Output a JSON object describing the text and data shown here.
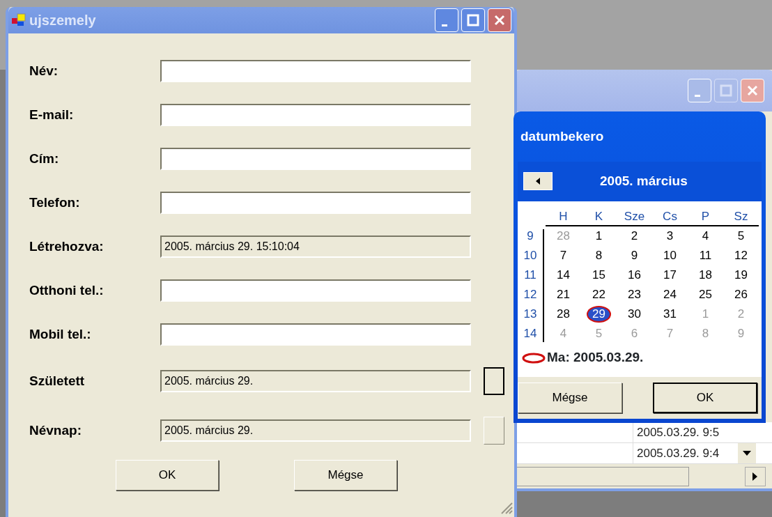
{
  "main_window": {
    "title": "ujszemely",
    "active": false,
    "fields": [
      {
        "label": "Név:",
        "readonly": false
      },
      {
        "label": "E-mail:",
        "readonly": false
      },
      {
        "label": "Cím:",
        "readonly": false
      },
      {
        "label": "Telefon:",
        "readonly": false
      },
      {
        "label": "Létrehozva:",
        "value": "2005. március 29. 15:10:04",
        "readonly": true
      },
      {
        "label": "Otthoni tel.:",
        "readonly": false
      },
      {
        "label": "Mobil tel.:",
        "readonly": false
      },
      {
        "label": "Született",
        "value": "2005. március 29.",
        "readonly": true,
        "picker": {
          "focused": true
        }
      },
      {
        "label": "Névnap:",
        "value": "2005. március 29.",
        "readonly": true,
        "picker": {
          "focused": false
        }
      }
    ],
    "buttons": [
      {
        "label": "OK",
        "default": false
      },
      {
        "label": "Mégse",
        "default": false
      }
    ]
  },
  "background_window": {
    "active": false,
    "maximize_disabled": true,
    "rows": [
      {
        "cells": [
          "2005.03.29. 9:5"
        ]
      },
      {
        "cells": [
          "2005.03.29. 9:4"
        ]
      }
    ]
  },
  "date_dialog": {
    "title": "datumbekero",
    "active": true,
    "month_label": "2005. március",
    "weekdays": [
      "H",
      "K",
      "Sze",
      "Cs",
      "P",
      "Sz"
    ],
    "weeks": [
      {
        "number": "9",
        "days": [
          {
            "day": "28",
            "other_month": true,
            "selected": false,
            "today": false
          },
          {
            "day": "1",
            "other_month": false,
            "selected": false,
            "today": false
          },
          {
            "day": "2",
            "other_month": false,
            "selected": false,
            "today": false
          },
          {
            "day": "3",
            "other_month": false,
            "selected": false,
            "today": false
          },
          {
            "day": "4",
            "other_month": false,
            "selected": false,
            "today": false
          },
          {
            "day": "5",
            "other_month": false,
            "selected": false,
            "today": false
          }
        ]
      },
      {
        "number": "10",
        "days": [
          {
            "day": "7",
            "other_month": false,
            "selected": false,
            "today": false
          },
          {
            "day": "8",
            "other_month": false,
            "selected": false,
            "today": false
          },
          {
            "day": "9",
            "other_month": false,
            "selected": false,
            "today": false
          },
          {
            "day": "10",
            "other_month": false,
            "selected": false,
            "today": false
          },
          {
            "day": "11",
            "other_month": false,
            "selected": false,
            "today": false
          },
          {
            "day": "12",
            "other_month": false,
            "selected": false,
            "today": false
          }
        ]
      },
      {
        "number": "11",
        "days": [
          {
            "day": "14",
            "other_month": false,
            "selected": false,
            "today": false
          },
          {
            "day": "15",
            "other_month": false,
            "selected": false,
            "today": false
          },
          {
            "day": "16",
            "other_month": false,
            "selected": false,
            "today": false
          },
          {
            "day": "17",
            "other_month": false,
            "selected": false,
            "today": false
          },
          {
            "day": "18",
            "other_month": false,
            "selected": false,
            "today": false
          },
          {
            "day": "19",
            "other_month": false,
            "selected": false,
            "today": false
          }
        ]
      },
      {
        "number": "12",
        "days": [
          {
            "day": "21",
            "other_month": false,
            "selected": false,
            "today": false
          },
          {
            "day": "22",
            "other_month": false,
            "selected": false,
            "today": false
          },
          {
            "day": "23",
            "other_month": false,
            "selected": false,
            "today": false
          },
          {
            "day": "24",
            "other_month": false,
            "selected": false,
            "today": false
          },
          {
            "day": "25",
            "other_month": false,
            "selected": false,
            "today": false
          },
          {
            "day": "26",
            "other_month": false,
            "selected": false,
            "today": false
          }
        ]
      },
      {
        "number": "13",
        "days": [
          {
            "day": "28",
            "other_month": false,
            "selected": false,
            "today": false
          },
          {
            "day": "29",
            "other_month": false,
            "selected": true,
            "today": true
          },
          {
            "day": "30",
            "other_month": false,
            "selected": false,
            "today": false
          },
          {
            "day": "31",
            "other_month": false,
            "selected": false,
            "today": false
          },
          {
            "day": "1",
            "other_month": true,
            "selected": false,
            "today": false
          },
          {
            "day": "2",
            "other_month": true,
            "selected": false,
            "today": false
          }
        ]
      },
      {
        "number": "14",
        "days": [
          {
            "day": "4",
            "other_month": true,
            "selected": false,
            "today": false
          },
          {
            "day": "5",
            "other_month": true,
            "selected": false,
            "today": false
          },
          {
            "day": "6",
            "other_month": true,
            "selected": false,
            "today": false
          },
          {
            "day": "7",
            "other_month": true,
            "selected": false,
            "today": false
          },
          {
            "day": "8",
            "other_month": true,
            "selected": false,
            "today": false
          },
          {
            "day": "9",
            "other_month": true,
            "selected": false,
            "today": false
          }
        ]
      }
    ],
    "today_label": "Ma: 2005.03.29.",
    "buttons": [
      {
        "label": "Mégse",
        "default": false
      },
      {
        "label": "OK",
        "default": true
      }
    ]
  }
}
